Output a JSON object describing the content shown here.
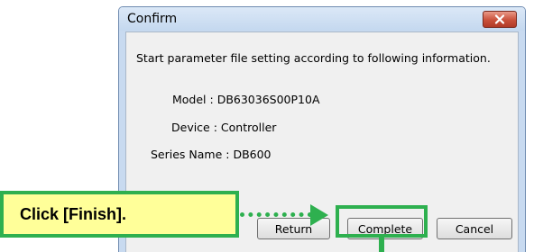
{
  "dialog": {
    "title": "Confirm",
    "message": "Start parameter file setting according to following information.",
    "model": "Model : DB63036S00P10A",
    "device": "Device : Controller",
    "series": "Series Name : DB600",
    "buttons": {
      "return_label": "Return",
      "complete_label": "Complete",
      "cancel_label": "Cancel"
    }
  },
  "annotation": {
    "callout_text": "Click [Finish]."
  },
  "colors": {
    "highlight": "#2eb04f",
    "callout_bg": "#ffff99",
    "close_button": "#c9503a"
  }
}
